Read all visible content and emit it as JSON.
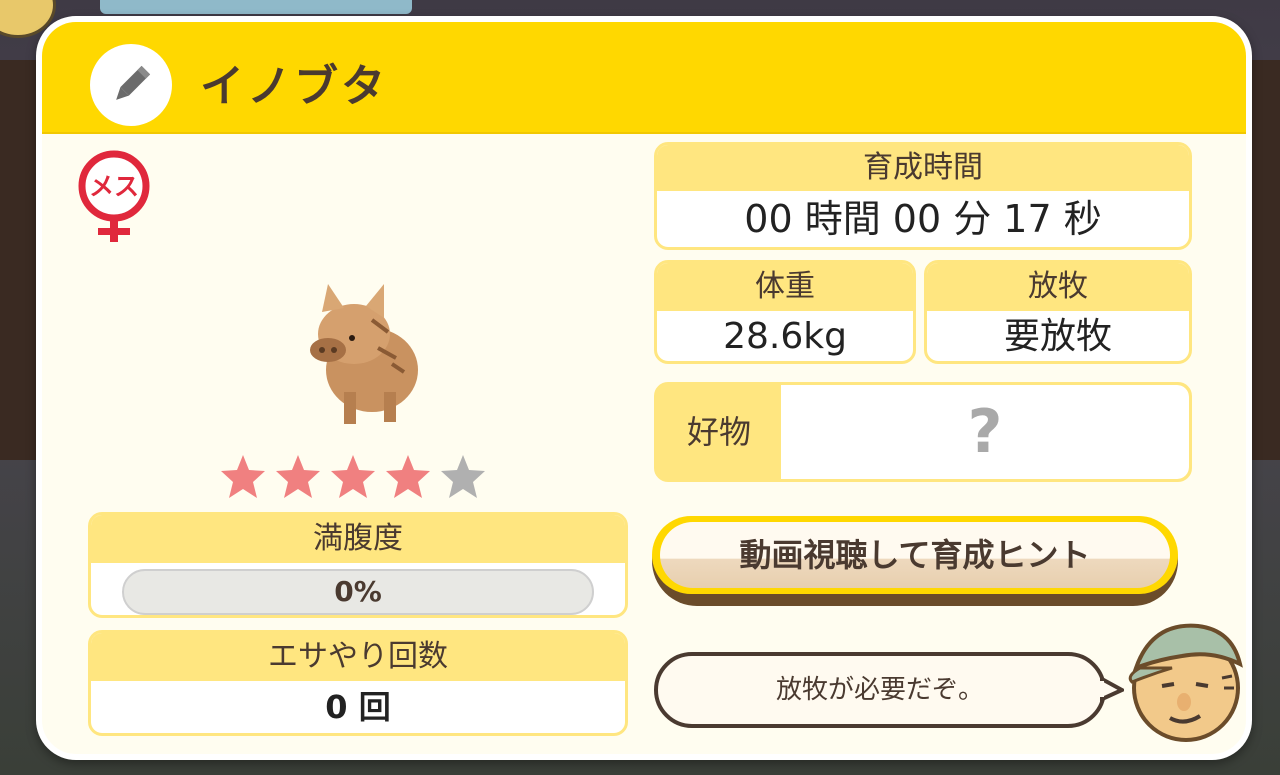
{
  "animal": {
    "name": "イノブタ",
    "gender_label": "メス",
    "rarity_stars": 4,
    "rarity_max": 5
  },
  "stats": {
    "satiety_label": "満腹度",
    "satiety_value": "0%",
    "satiety_fraction": 0,
    "feed_count_label": "エサやり回数",
    "feed_count_value": "0 回",
    "time_label": "育成時間",
    "time_value": "00 時間 00 分 17 秒",
    "weight_label": "体重",
    "weight_value": "28.6kg",
    "graze_label": "放牧",
    "graze_value": "要放牧",
    "favorite_label": "好物",
    "favorite_value": "?"
  },
  "actions": {
    "hint_button_label": "動画視聴して育成ヒント"
  },
  "advisor": {
    "message": "放牧が必要だぞ。"
  },
  "colors": {
    "header": "#ffd800",
    "label_bg": "#ffe680",
    "star_on": "#f08080",
    "star_off": "#b0b0b0",
    "gender": "#e0283c"
  }
}
